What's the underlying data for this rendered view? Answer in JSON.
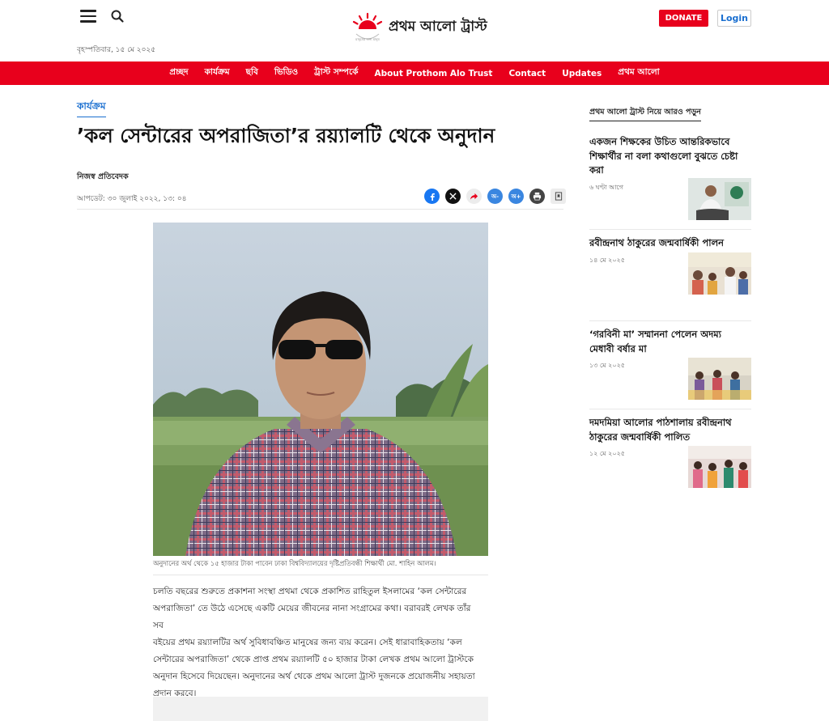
{
  "header": {
    "logo_text": "প্রথম আলো ট্রাস্ট",
    "logo_tagline": "মানুষের জন্য মানুষ",
    "date": "বৃহস্পতিবার, ১৫ মে ২০২৫",
    "donate_label": "DONATE",
    "login_label": "Login",
    "menu_icon": "hamburger-icon",
    "search_icon": "search-icon"
  },
  "nav": {
    "items": [
      "প্রচ্ছদ",
      "কার্যক্রম",
      "ছবি",
      "ভিডিও",
      "ট্রাস্ট সম্পর্কে",
      "About Prothom Alo Trust",
      "Contact",
      "Updates",
      "প্রথম আলো"
    ]
  },
  "article": {
    "category": "কার্যক্রম",
    "headline": "’কল সেন্টারের অপরাজিতা’র রয়্যালটি থেকে অনুদান",
    "author": "নিজস্ব প্রতিবেদক",
    "updated": "আপডেট: ৩০ জুলাই ২০২২, ১৩: ০৪",
    "caption": "অনুদানের অর্থ থেকে ১৫ হাজার টাকা পাবেন ঢাকা বিশ্ববিদ্যালয়ের দৃষ্টিপ্রতিবন্ধী শিক্ষার্থী মো. শাহিন আলম।",
    "body": [
      "চলতি বছরের শুরুতে প্রকাশনা সংস্থা প্রথমা থেকে প্রকাশিত রাহিতুল ইসলামের ‘কল সেন্টারের",
      "অপরাজিতা’ তে উঠে এসেছে একটি মেয়ের জীবনের নানা সংগ্রামের কথা। বরাবরই লেখক তাঁর সব",
      "বইয়ের প্রথম রয়্যালটির অর্থ সুবিধাবঞ্চিত মানুষের জন্য ব্যয় করেন। সেই ধারাবাহিকতায় ‘কল",
      "সেন্টারের অপরাজিতা’ থেকে প্রাপ্ত প্রথম রয়্যালটি ৫০ হাজার টাকা লেখক প্রথম আলো ট্রাস্টকে",
      "অনুদান হিসেবে দিয়েছেন। অনুদানের অর্থ থেকে প্রথম আলো ট্রাস্ট দুজনকে প্রয়োজনীয় সহায়তা",
      "প্রদান করবে।"
    ],
    "share": {
      "facebook_icon": "facebook-icon",
      "x_icon": "x-icon",
      "share_icon": "share-icon",
      "font_decrease_label": "অ-",
      "font_increase_label": "অ+",
      "font_default_label": "অ-",
      "print_icon": "print-icon",
      "save_icon": "bookmark-icon"
    }
  },
  "sidebar": {
    "title": "প্রথম আলো ট্রাস্ট নিয়ে আরও পড়ুন",
    "items": [
      {
        "title": "একজন শিক্ষকের উচিত আন্তরিকভাবে শিক্ষার্থীর না বলা কথাগুলো বুঝতে চেষ্টা করা",
        "time": "৬ ঘণ্টা আগে"
      },
      {
        "title": "রবীন্দ্রনাথ ঠাকুরের জন্মবার্ষিকী পালন",
        "time": "১৪ মে ২০২৫"
      },
      {
        "title": "‘গরবিনী মা’ সম্মাননা পেলেন অদম্য মেধাবী বর্ষার মা",
        "time": "১৩ মে ২০২৫"
      },
      {
        "title": "দমদমিয়া আলোর পাঠশালায় রবীন্দ্রনাথ ঠাকুরের জন্মবার্ষিকী পালিত",
        "time": "১২ মে ২০২৫"
      }
    ]
  },
  "colors": {
    "brand_red": "#e8001c",
    "link_blue": "#1a6fd0"
  }
}
